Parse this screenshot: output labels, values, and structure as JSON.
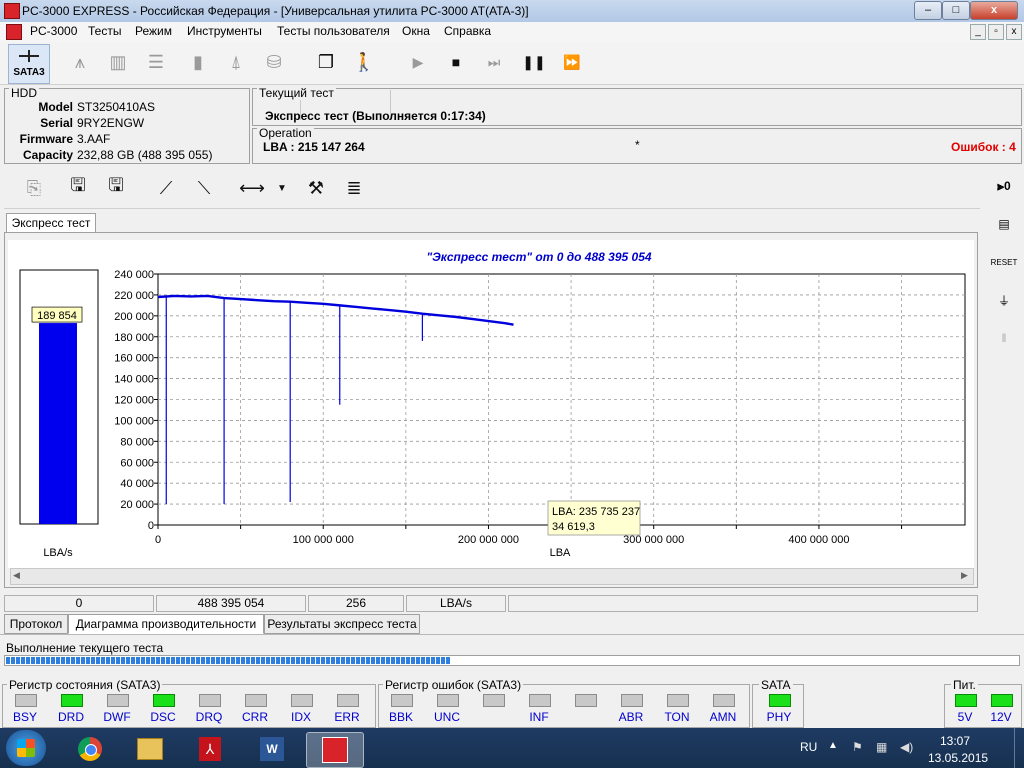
{
  "window": {
    "title": "PC-3000 EXPRESS - Российская Федерация - [Универсальная утилита PC-3000 AT(ATA-3)]",
    "minimize": "–",
    "maximize": "□",
    "close": "x"
  },
  "menu": {
    "items": [
      "PC-3000",
      "Тесты",
      "Режим",
      "Инструменты",
      "Тесты пользователя",
      "Окна",
      "Справка"
    ],
    "mdi_min": "_",
    "mdi_restore": "▫",
    "mdi_close": "x"
  },
  "toolbar": {
    "sata_label": "SATA3"
  },
  "hdd": {
    "group_label": "HDD",
    "fields": [
      {
        "label": "Model",
        "value": "ST3250410AS"
      },
      {
        "label": "Serial",
        "value": "9RY2ENGW"
      },
      {
        "label": "Firmware",
        "value": "3.AAF"
      },
      {
        "label": "Capacity",
        "value": "232,88 GB (488 395 055)"
      }
    ]
  },
  "current_test": {
    "group_label": "Текущий тест",
    "text": "Экспресс тест (Выполняется 0:17:34)"
  },
  "operation": {
    "group_label": "Operation",
    "lba_text": "LBA : 215 147 264",
    "errors_text": "Ошибок : 4",
    "marker": "*"
  },
  "chart_tab": {
    "label": "Экспресс тест"
  },
  "chart_data": {
    "type": "line",
    "title": "\"Экспресс тест\" от 0 до 488 395 054",
    "xlabel": "LBA",
    "ylabel": "",
    "xlim": [
      0,
      488395054
    ],
    "ylim": [
      0,
      240000
    ],
    "y_ticks": [
      "0",
      "20 000",
      "40 000",
      "60 000",
      "80 000",
      "100 000",
      "120 000",
      "140 000",
      "160 000",
      "180 000",
      "200 000",
      "220 000",
      "240 000"
    ],
    "x_ticks": [
      "0",
      "100 000 000",
      "200 000 000",
      "300 000 000",
      "400 000 000"
    ],
    "grid": true,
    "series": [
      {
        "color": "#0000dd",
        "x": [
          0,
          10000000,
          20000000,
          30000000,
          40000000,
          50000000,
          60000000,
          70000000,
          80000000,
          90000000,
          100000000,
          110000000,
          120000000,
          130000000,
          140000000,
          150000000,
          160000000,
          170000000,
          180000000,
          190000000,
          200000000,
          210000000,
          215147264
        ],
        "y": [
          218000,
          219000,
          218500,
          219000,
          217000,
          216000,
          215000,
          214000,
          213500,
          212500,
          211500,
          210000,
          208500,
          207000,
          205500,
          204000,
          202000,
          200500,
          199000,
          197000,
          195000,
          193000,
          191500
        ]
      }
    ],
    "dips": [
      {
        "x": 5000000,
        "y": 20000
      },
      {
        "x": 40000000,
        "y": 20000
      },
      {
        "x": 80000000,
        "y": 22000
      },
      {
        "x": 110000000,
        "y": 115000
      },
      {
        "x": 160000000,
        "y": 176000
      }
    ],
    "tooltip": {
      "lba": "LBA: 235 735 237",
      "value": "34 619,3"
    },
    "gauge": {
      "value": 189854,
      "label": "189 854",
      "unit": "LBA/s"
    }
  },
  "statusbar": {
    "cells": [
      "0",
      "488 395 054",
      "256",
      "LBA/s"
    ]
  },
  "bottom_tabs": [
    "Протокол",
    "Диаграмма производительности",
    "Результаты экспресс теста"
  ],
  "progress": {
    "label": "Выполнение текущего теста",
    "fraction": 0.44
  },
  "status_register": {
    "label": "Регистр состояния (SATA3)",
    "leds": [
      {
        "name": "BSY",
        "on": false
      },
      {
        "name": "DRD",
        "on": true
      },
      {
        "name": "DWF",
        "on": false
      },
      {
        "name": "DSC",
        "on": true
      },
      {
        "name": "DRQ",
        "on": false
      },
      {
        "name": "CRR",
        "on": false
      },
      {
        "name": "IDX",
        "on": false
      },
      {
        "name": "ERR",
        "on": false
      }
    ]
  },
  "error_register": {
    "label": "Регистр ошибок (SATA3)",
    "leds": [
      {
        "name": "BBK",
        "on": false
      },
      {
        "name": "UNC",
        "on": false
      },
      {
        "name": "",
        "on": false
      },
      {
        "name": "INF",
        "on": false
      },
      {
        "name": "",
        "on": false
      },
      {
        "name": "ABR",
        "on": false
      },
      {
        "name": "TON",
        "on": false
      },
      {
        "name": "AMN",
        "on": false
      }
    ]
  },
  "sata": {
    "label": "SATA",
    "leds": [
      {
        "name": "PHY",
        "on": true
      }
    ]
  },
  "power": {
    "label": "Пит.",
    "leds": [
      {
        "name": "5V",
        "on": true
      },
      {
        "name": "12V",
        "on": true
      }
    ]
  },
  "taskbar": {
    "lang": "RU",
    "time": "13:07",
    "date": "13.05.2015"
  }
}
